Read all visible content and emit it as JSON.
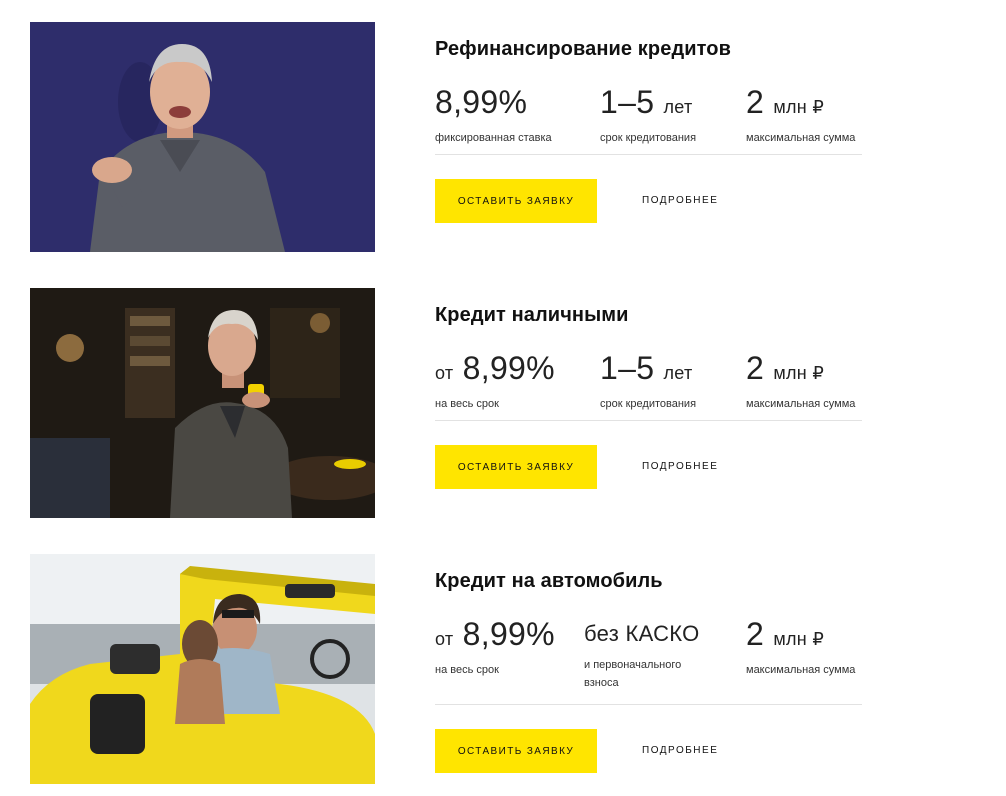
{
  "colors": {
    "accent": "#ffe500",
    "text": "#111111",
    "caption": "#333333",
    "divider": "#e2e2e2"
  },
  "products": [
    {
      "title": "Рефинансирование кредитов",
      "image": "man-gesturing-on-blue-background",
      "stats": [
        {
          "prefix": "",
          "value": "8,99%",
          "unit": "",
          "caption": "фиксированная ставка"
        },
        {
          "prefix": "",
          "value": "1–5",
          "unit": "лет",
          "caption": "срок кредитования"
        },
        {
          "prefix": "",
          "value": "2",
          "unit": "млн ₽",
          "caption": "максимальная сумма"
        }
      ],
      "apply_label": "Оставить заявку",
      "more_label": "Подробнее"
    },
    {
      "title": "Кредит наличными",
      "image": "man-with-coffee-cup-in-cafe",
      "stats": [
        {
          "prefix": "от",
          "value": "8,99%",
          "unit": "",
          "caption": "на весь срок"
        },
        {
          "prefix": "",
          "value": "1–5",
          "unit": "лет",
          "caption": "срок кредитования"
        },
        {
          "prefix": "",
          "value": "2",
          "unit": "млн ₽",
          "caption": "максимальная сумма"
        }
      ],
      "apply_label": "Оставить заявку",
      "more_label": "Подробнее"
    },
    {
      "title": "Кредит на автомобиль",
      "image": "couple-in-yellow-convertible",
      "stats": [
        {
          "prefix": "от",
          "value": "8,99%",
          "unit": "",
          "caption": "на весь срок"
        },
        {
          "prefix": "",
          "value": "без КАСКО",
          "unit": "",
          "caption": "и первоначального\nвзноса"
        },
        {
          "prefix": "",
          "value": "2",
          "unit": "млн ₽",
          "caption": "максимальная сумма"
        }
      ],
      "apply_label": "Оставить заявку",
      "more_label": "Подробнее"
    }
  ]
}
